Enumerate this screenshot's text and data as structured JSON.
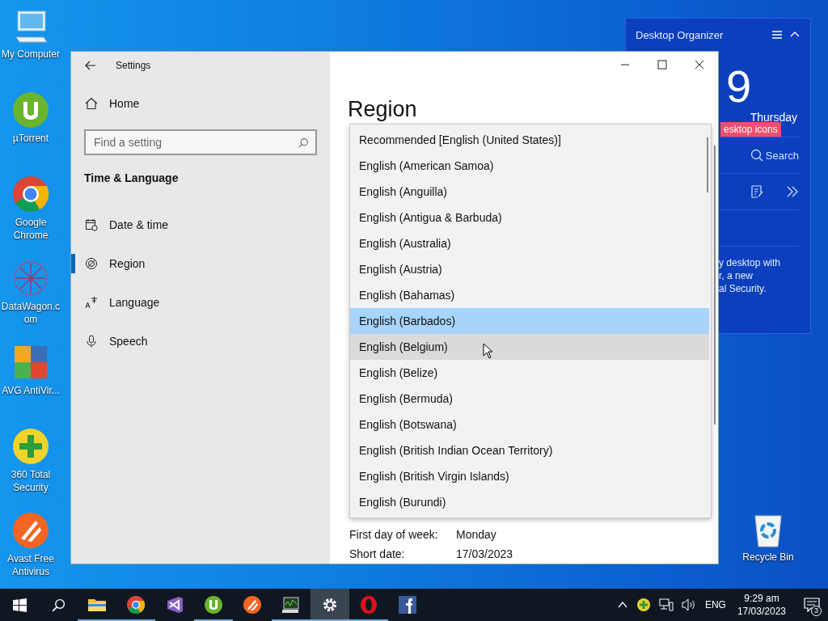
{
  "desktop_icons": [
    {
      "label": "My Computer",
      "kind": "computer"
    },
    {
      "label": "µTorrent",
      "kind": "utorrent"
    },
    {
      "label": "Google Chrome",
      "kind": "chrome"
    },
    {
      "label": "DataWagon.com",
      "kind": "datawagon"
    },
    {
      "label": "AVG AntiVir...",
      "kind": "avg"
    },
    {
      "label": "360 Total Security",
      "kind": "plus"
    },
    {
      "label": "Avast Free Antivirus",
      "kind": "avast"
    }
  ],
  "recycle_bin": {
    "label": "Recycle Bin"
  },
  "organizer": {
    "title": "Desktop Organizer",
    "clock": "9",
    "day": "Thursday",
    "tag": "esktop icons",
    "search": "Search",
    "text_lines": [
      "y desktop with",
      "r, a new",
      "al Security."
    ]
  },
  "settings": {
    "title": "Settings",
    "home": "Home",
    "search": {
      "placeholder": "Find a setting"
    },
    "section": "Time & Language",
    "nav": [
      {
        "label": "Date & time",
        "kind": "calendar",
        "selected": false
      },
      {
        "label": "Region",
        "kind": "globe",
        "selected": true
      },
      {
        "label": "Language",
        "kind": "language",
        "selected": false
      },
      {
        "label": "Speech",
        "kind": "mic",
        "selected": false
      }
    ],
    "heading": "Region",
    "dropdown": [
      {
        "label": "Recommended [English (United States)]",
        "selected": false,
        "hovered": false
      },
      {
        "label": "English (American Samoa)",
        "selected": false,
        "hovered": false
      },
      {
        "label": "English (Anguilla)",
        "selected": false,
        "hovered": false
      },
      {
        "label": "English (Antigua & Barbuda)",
        "selected": false,
        "hovered": false
      },
      {
        "label": "English (Australia)",
        "selected": false,
        "hovered": false
      },
      {
        "label": "English (Austria)",
        "selected": false,
        "hovered": false
      },
      {
        "label": "English (Bahamas)",
        "selected": false,
        "hovered": false
      },
      {
        "label": "English (Barbados)",
        "selected": true,
        "hovered": false
      },
      {
        "label": "English (Belgium)",
        "selected": false,
        "hovered": true
      },
      {
        "label": "English (Belize)",
        "selected": false,
        "hovered": false
      },
      {
        "label": "English (Bermuda)",
        "selected": false,
        "hovered": false
      },
      {
        "label": "English (Botswana)",
        "selected": false,
        "hovered": false
      },
      {
        "label": "English (British Indian Ocean Territory)",
        "selected": false,
        "hovered": false
      },
      {
        "label": "English (British Virgin Islands)",
        "selected": false,
        "hovered": false
      },
      {
        "label": "English (Burundi)",
        "selected": false,
        "hovered": false
      }
    ],
    "details": [
      {
        "label": "First day of week:",
        "value": "Monday"
      },
      {
        "label": "Short date:",
        "value": "17/03/2023"
      }
    ]
  },
  "taskbar": {
    "apps": [
      {
        "kind": "folder",
        "active": false,
        "running": true
      },
      {
        "kind": "chrome",
        "active": false,
        "running": true
      },
      {
        "kind": "studio",
        "active": false,
        "running": false
      },
      {
        "kind": "utorrent",
        "active": false,
        "running": true
      },
      {
        "kind": "avast",
        "active": false,
        "running": false
      },
      {
        "kind": "monitor",
        "active": false,
        "running": true
      },
      {
        "kind": "gear",
        "active": true,
        "running": true
      },
      {
        "kind": "opera",
        "active": false,
        "running": true
      },
      {
        "kind": "facebook",
        "active": false,
        "running": false
      }
    ],
    "language": "ENG",
    "time": "9:29 am",
    "date": "17/03/2023",
    "notifications": "3"
  }
}
